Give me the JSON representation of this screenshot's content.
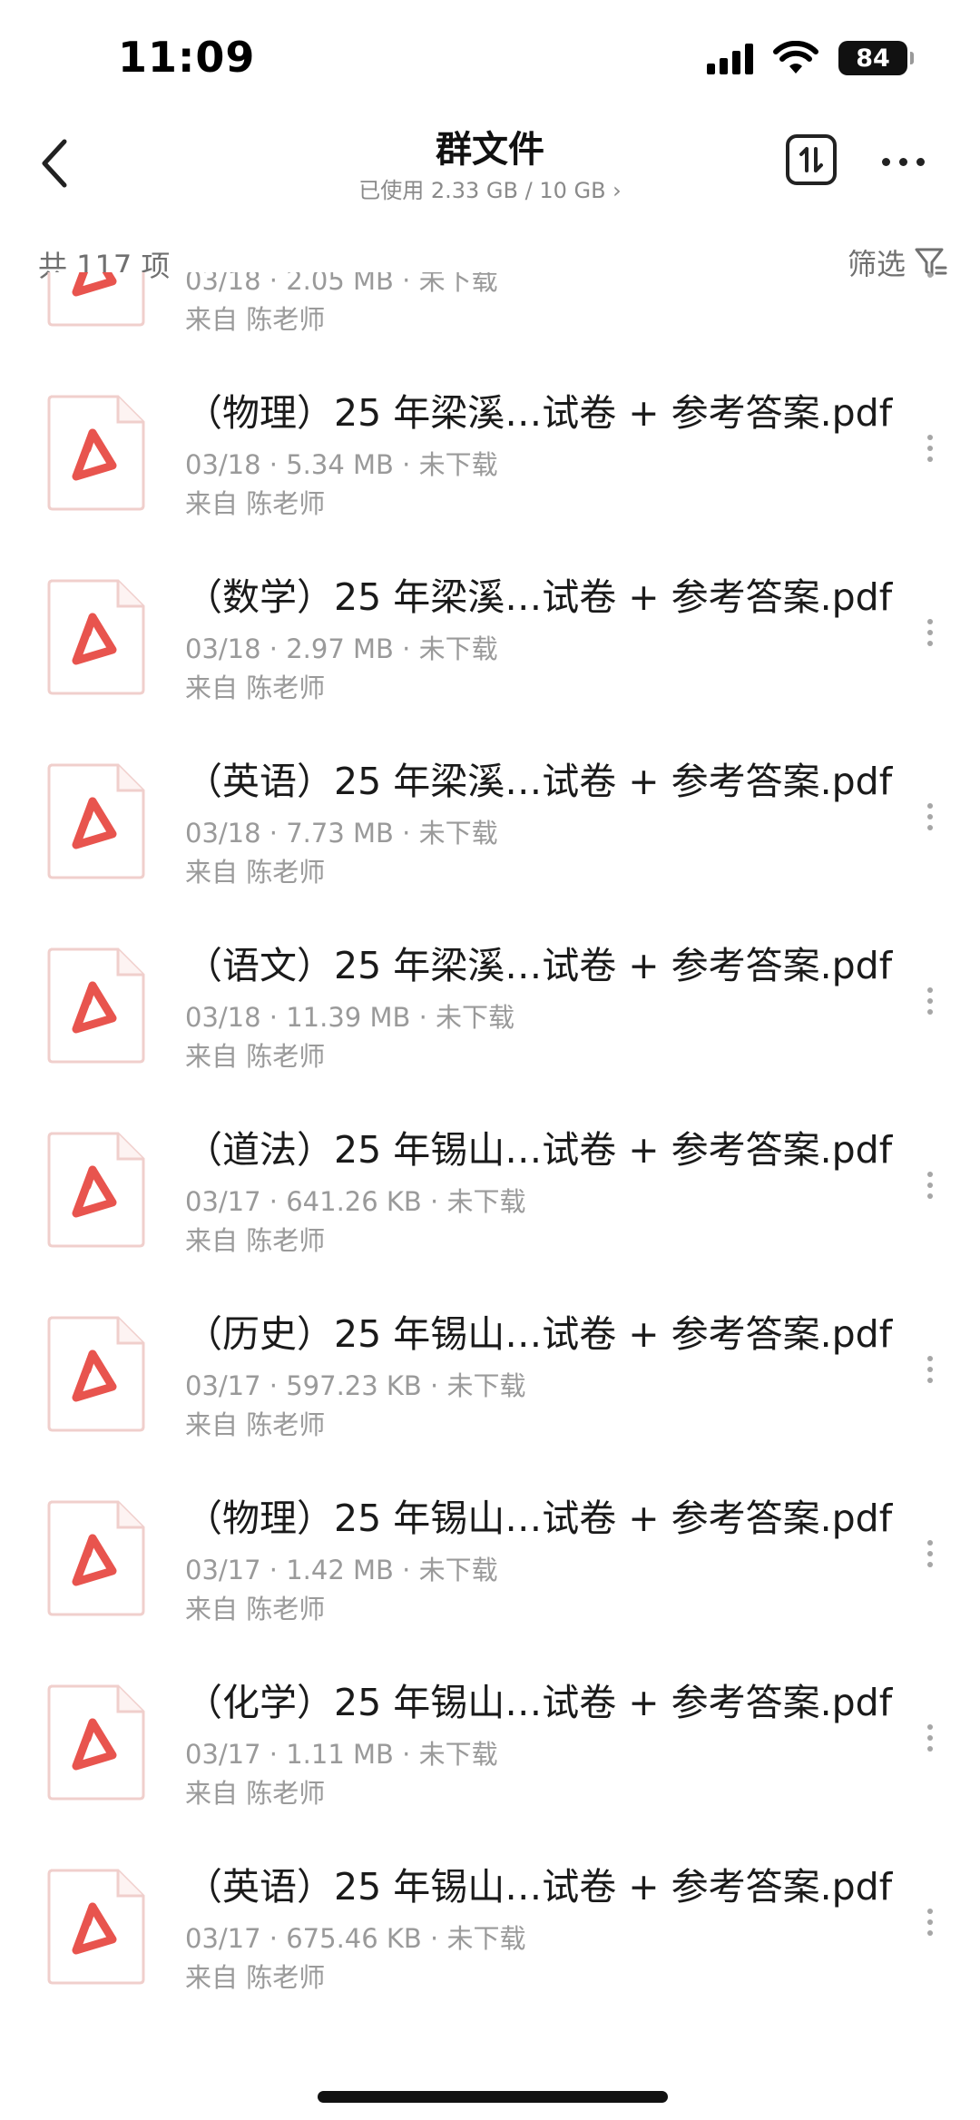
{
  "status_bar": {
    "time": "11:09",
    "battery": "84"
  },
  "header": {
    "title": "群文件",
    "storage": "已使用 2.33 GB / 10 GB ›"
  },
  "toolbar": {
    "count": "共 117 项",
    "filter_label": "筛选"
  },
  "files": [
    {
      "name": "",
      "meta": "03/18 · 2.05 MB · 未下载",
      "source": "来自 陈老师"
    },
    {
      "name": "（物理）25 年梁溪…试卷 + 参考答案.pdf",
      "meta": "03/18 · 5.34 MB · 未下载",
      "source": "来自 陈老师"
    },
    {
      "name": "（数学）25 年梁溪…试卷 + 参考答案.pdf",
      "meta": "03/18 · 2.97 MB · 未下载",
      "source": "来自 陈老师"
    },
    {
      "name": "（英语）25 年梁溪…试卷 + 参考答案.pdf",
      "meta": "03/18 · 7.73 MB · 未下载",
      "source": "来自 陈老师"
    },
    {
      "name": "（语文）25 年梁溪…试卷 + 参考答案.pdf",
      "meta": "03/18 · 11.39 MB · 未下载",
      "source": "来自 陈老师"
    },
    {
      "name": "（道法）25 年锡山…试卷 + 参考答案.pdf",
      "meta": "03/17 · 641.26 KB · 未下载",
      "source": "来自 陈老师"
    },
    {
      "name": "（历史）25 年锡山…试卷 + 参考答案.pdf",
      "meta": "03/17 · 597.23 KB · 未下载",
      "source": "来自 陈老师"
    },
    {
      "name": "（物理）25 年锡山…试卷 + 参考答案.pdf",
      "meta": "03/17 · 1.42 MB · 未下载",
      "source": "来自 陈老师"
    },
    {
      "name": "（化学）25 年锡山…试卷 + 参考答案.pdf",
      "meta": "03/17 · 1.11 MB · 未下载",
      "source": "来自 陈老师"
    },
    {
      "name": "（英语）25 年锡山…试卷 + 参考答案.pdf",
      "meta": "03/17 · 675.46 KB · 未下载",
      "source": "来自 陈老师"
    }
  ],
  "icons": {
    "file_type": "pdf-file-icon",
    "pdf_accent": "#e8544e",
    "file_border": "#f0cfcc"
  }
}
